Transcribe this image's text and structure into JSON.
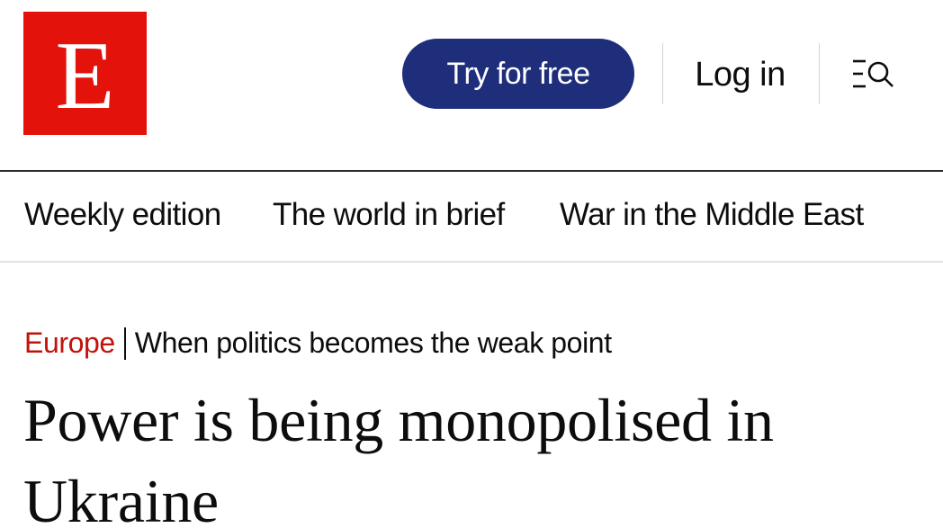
{
  "header": {
    "logo_letter": "E",
    "try_label": "Try for free",
    "login_label": "Log in",
    "menu_search_icon": "menu-search-icon"
  },
  "colors": {
    "brand_red": "#e3120b",
    "button_navy": "#1f2e7a",
    "section_red": "#c3120b"
  },
  "nav": {
    "items": [
      {
        "label": "Weekly edition"
      },
      {
        "label": "The world in brief"
      },
      {
        "label": "War in the Middle East"
      }
    ]
  },
  "article": {
    "section": "Europe",
    "separator": "|",
    "flytitle": "When politics becomes the weak point",
    "headline": "Power is being monopolised in Ukraine"
  }
}
